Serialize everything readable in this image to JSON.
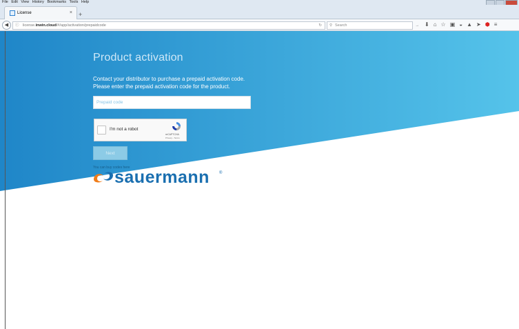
{
  "browser": {
    "menu": [
      "File",
      "Edit",
      "View",
      "History",
      "Bookmarks",
      "Tools",
      "Help"
    ],
    "tab": {
      "title": "License",
      "close": "×"
    },
    "new_tab": "+",
    "url": {
      "prefix": "license.",
      "domain": "inwin.cloud",
      "path": "/#/app/activation/prepaidcode"
    },
    "search_placeholder": "Search",
    "toolbar_icons": [
      "download-icon",
      "home-icon",
      "bookmark-star-icon",
      "reading-list-icon",
      "pocket-icon",
      "extension-icon",
      "send-icon",
      "adblock-icon",
      "menu-icon"
    ],
    "colors": {
      "chrome": "#dfe8f2",
      "adblock": "#d22222"
    }
  },
  "page": {
    "title": "Product activation",
    "description_line1": "Contact your distributor to purchase a prepaid activation code.",
    "description_line2": "Please enter the prepaid activation code for the product.",
    "code_placeholder": "Prepaid code",
    "captcha": {
      "label": "I'm not a robot",
      "brand": "reCAPTCHA",
      "terms": "Privacy - Terms"
    },
    "next_label": "Next",
    "buy_link": "You can buy codes here",
    "logo": {
      "text": "sauermann",
      "mark": "®"
    },
    "colors": {
      "gradient_start": "#1f86c8",
      "gradient_end": "#55c3ea",
      "brand": "#1a6fb0"
    }
  }
}
